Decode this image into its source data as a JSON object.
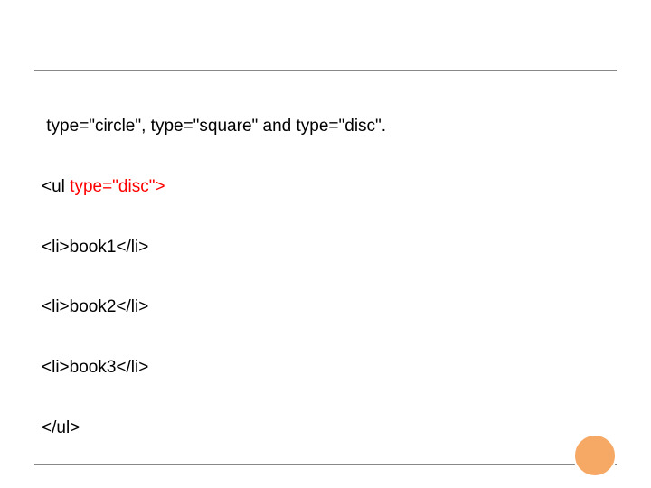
{
  "lines": {
    "l1a": " type=\"circle\", type=\"square\" and type=\"disc\".",
    "l2a": "<ul ",
    "l2b": "type=\"disc\">",
    "l3": "<li>book1</li>",
    "l4": "<li>book2</li>",
    "l5": "<li>book3</li>",
    "l6": "</ul>"
  }
}
